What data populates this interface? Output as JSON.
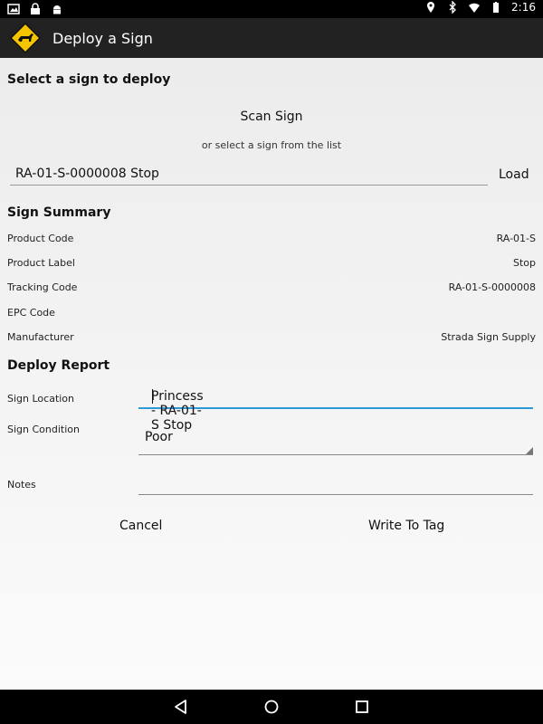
{
  "status_bar": {
    "time": "2:16"
  },
  "app_bar": {
    "title": "Deploy a Sign"
  },
  "select_section": {
    "heading": "Select a sign to deploy",
    "scan_label": "Scan Sign",
    "hint": "or select a sign from the list",
    "selected_sign": "RA-01-S-0000008 Stop",
    "load_label": "Load"
  },
  "summary": {
    "heading": "Sign Summary",
    "rows": [
      {
        "label": "Product Code",
        "value": "RA-01-S"
      },
      {
        "label": "Product Label",
        "value": "Stop"
      },
      {
        "label": "Tracking Code",
        "value": "RA-01-S-0000008"
      },
      {
        "label": "EPC Code",
        "value": ""
      },
      {
        "label": "Manufacturer",
        "value": "Strada Sign Supply"
      }
    ]
  },
  "deploy_report": {
    "heading": "Deploy Report",
    "location_label": "Sign Location",
    "location_value": "Princess - RA-01-S Stop",
    "condition_label": "Sign Condition",
    "condition_value": "Poor",
    "notes_label": "Notes",
    "notes_value": ""
  },
  "actions": {
    "cancel": "Cancel",
    "write": "Write To Tag"
  },
  "colors": {
    "accent": "#2a9ad8",
    "appbar": "#222222",
    "logo_yellow": "#f5c400"
  }
}
